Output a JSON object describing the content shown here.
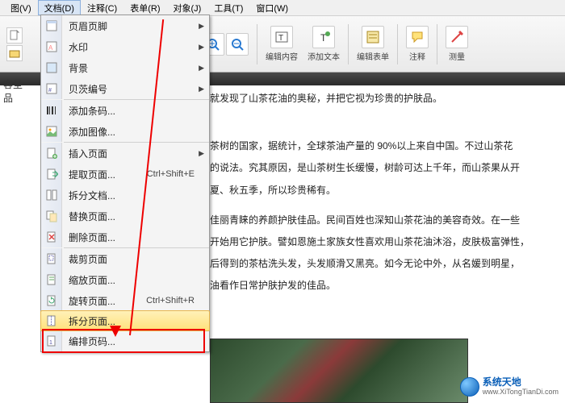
{
  "menubar": {
    "items": [
      "图(V)",
      "文档(D)",
      "注释(C)",
      "表单(R)",
      "对象(J)",
      "工具(T)",
      "窗口(W)"
    ],
    "active_index": 1
  },
  "toolbar": {
    "groups": [
      {
        "label": "编辑内容"
      },
      {
        "label": "添加文本"
      },
      {
        "label": "编辑表单"
      },
      {
        "label": "注释"
      },
      {
        "label": "测量"
      }
    ]
  },
  "dropdown": {
    "items": [
      {
        "label": "页眉页脚",
        "has_sub": true,
        "icon": "header-footer-icon"
      },
      {
        "label": "水印",
        "has_sub": true,
        "icon": "watermark-icon"
      },
      {
        "label": "背景",
        "has_sub": true,
        "icon": "background-icon"
      },
      {
        "label": "贝茨编号",
        "has_sub": true,
        "icon": "bates-icon"
      },
      {
        "sep": true
      },
      {
        "label": "添加条码...",
        "icon": "barcode-icon"
      },
      {
        "label": "添加图像...",
        "icon": "image-icon"
      },
      {
        "sep": true
      },
      {
        "label": "插入页面",
        "has_sub": true,
        "icon": "insert-page-icon"
      },
      {
        "label": "提取页面...",
        "shortcut": "Ctrl+Shift+E",
        "icon": "extract-page-icon"
      },
      {
        "label": "拆分文档...",
        "icon": "split-doc-icon"
      },
      {
        "label": "替换页面...",
        "icon": "replace-page-icon"
      },
      {
        "label": "删除页面...",
        "icon": "delete-page-icon"
      },
      {
        "sep": true
      },
      {
        "label": "裁剪页面",
        "icon": "crop-page-icon"
      },
      {
        "label": "缩放页面...",
        "icon": "zoom-page-icon"
      },
      {
        "label": "旋转页面...",
        "shortcut": "Ctrl+Shift+R",
        "icon": "rotate-page-icon"
      },
      {
        "label": "拆分页面...",
        "icon": "split-page-icon",
        "highlight": true
      },
      {
        "label": "编排页码...",
        "icon": "number-page-icon"
      }
    ]
  },
  "content": {
    "lines": [
      "就发现了山茶花油的奥秘，并把它视为珍贵的护肤品。",
      "茶树的国家，据统计，全球茶油产量的 90%以上来自中国。不过山茶花",
      "的说法。究其原因，是山茶树生长缓慢，树龄可达上千年，而山茶果从开",
      "夏、秋五季，所以珍贵稀有。",
      "佳丽青睐的养颜护肤佳品。民间百姓也深知山茶花油的美容奇效。在一些",
      "开始用它护肤。譬如恩施土家族女性喜欢用山茶花油沐浴，皮肤极富弹性，",
      "后得到的茶枯洗头发，头发顺滑又黑亮。如今无论中外，从名媛到明星，",
      "油看作日常护肤护发的佳品。"
    ],
    "left_fragment": "容圣品"
  },
  "watermark": {
    "name": "系统天地",
    "url": "www.XiTongTianDi.com"
  }
}
